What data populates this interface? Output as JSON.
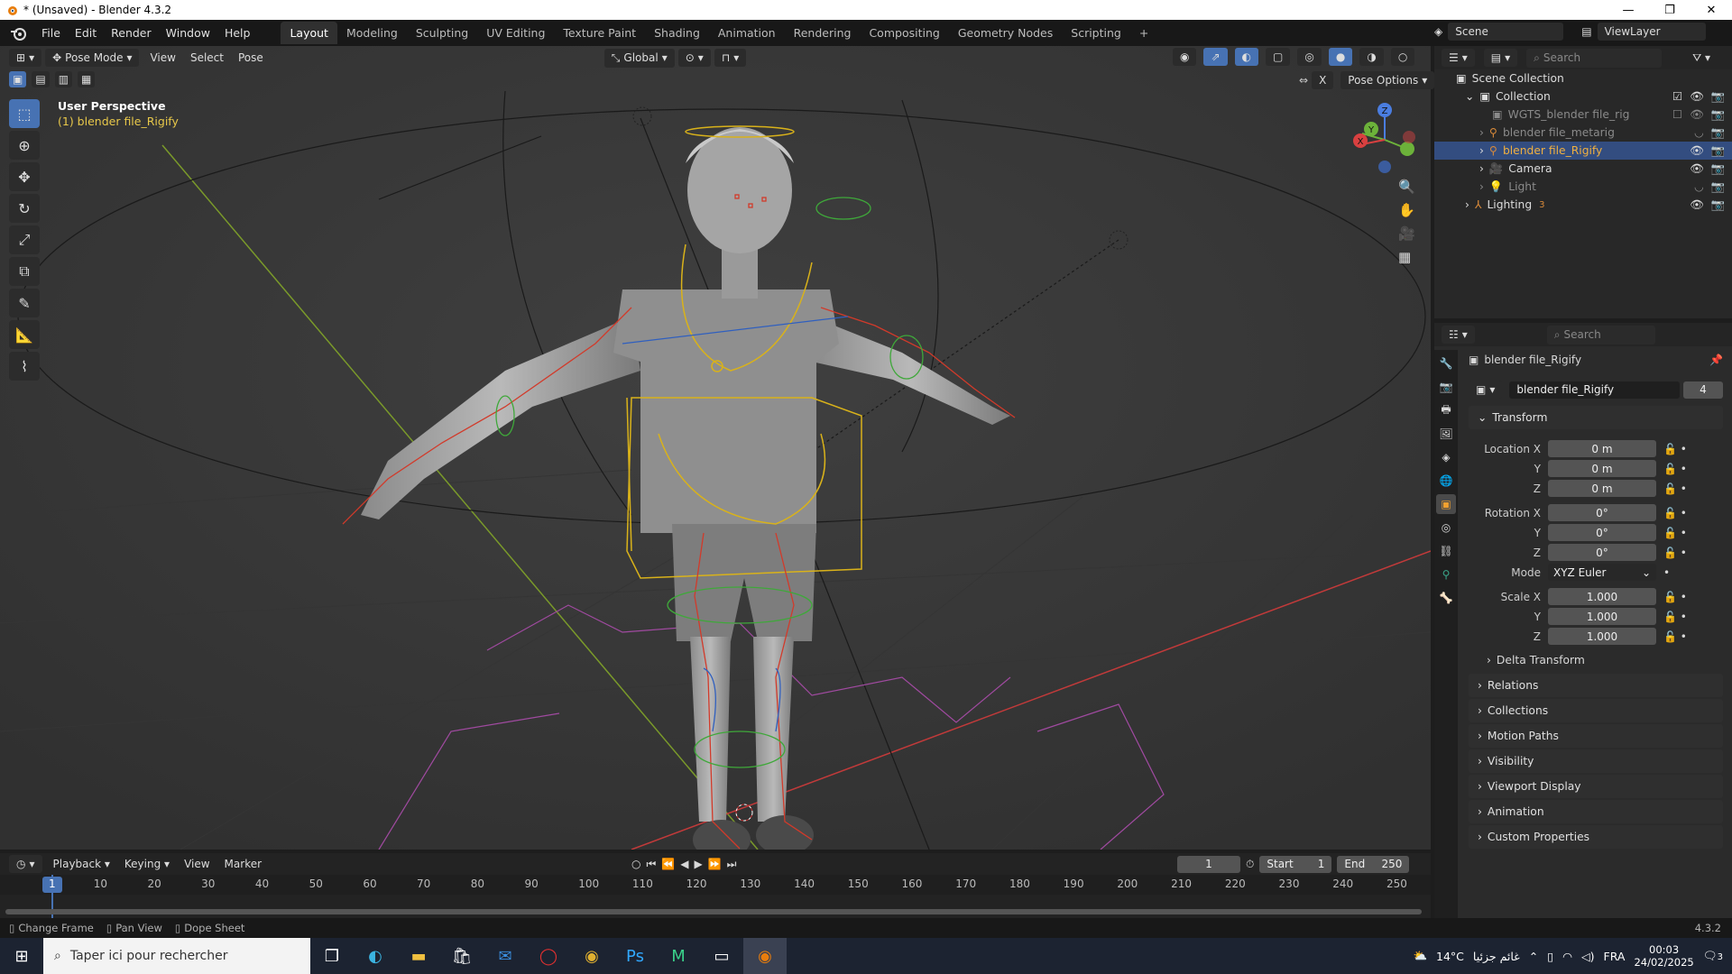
{
  "window": {
    "title": "* (Unsaved) - Blender 4.3.2",
    "minimize": "—",
    "maximize": "❐",
    "close": "✕"
  },
  "menu": [
    "File",
    "Edit",
    "Render",
    "Window",
    "Help"
  ],
  "workspaces": [
    "Layout",
    "Modeling",
    "Sculpting",
    "UV Editing",
    "Texture Paint",
    "Shading",
    "Animation",
    "Rendering",
    "Compositing",
    "Geometry Nodes",
    "Scripting",
    "+"
  ],
  "active_workspace": "Layout",
  "scene": {
    "label": "Scene",
    "viewlayer": "ViewLayer"
  },
  "viewport": {
    "mode": "Pose Mode",
    "view": "View",
    "select": "Select",
    "pose": "Pose",
    "transform_orientation": "Global",
    "pose_options": "Pose Options",
    "overlay_title": "User Perspective",
    "overlay_object": "(1) blender file_Rigify",
    "gizmo": {
      "x": "X",
      "y": "Y",
      "z": "Z"
    },
    "x_mirror": "X"
  },
  "outliner": {
    "search_placeholder": "Search",
    "items": [
      {
        "label": "Scene Collection",
        "indent": 0
      },
      {
        "label": "Collection",
        "indent": 1
      },
      {
        "label": "WGTS_blender file_rig",
        "indent": 2,
        "dim": true
      },
      {
        "label": "blender file_metarig",
        "indent": 2,
        "dim": true
      },
      {
        "label": "blender file_Rigify",
        "indent": 2,
        "selected": true
      },
      {
        "label": "Camera",
        "indent": 2
      },
      {
        "label": "Light",
        "indent": 2,
        "dim": true
      },
      {
        "label": "Lighting",
        "indent": 1,
        "badge": "3"
      }
    ]
  },
  "properties": {
    "search_placeholder": "Search",
    "object_name": "blender file_Rigify",
    "data_name": "blender file_Rigify",
    "users": "4",
    "transform_label": "Transform",
    "location": {
      "label_x": "Location X",
      "label_y": "Y",
      "label_z": "Z",
      "x": "0 m",
      "y": "0 m",
      "z": "0 m"
    },
    "rotation": {
      "label_x": "Rotation X",
      "label_y": "Y",
      "label_z": "Z",
      "x": "0°",
      "y": "0°",
      "z": "0°"
    },
    "mode": {
      "label": "Mode",
      "value": "XYZ Euler"
    },
    "scale": {
      "label_x": "Scale X",
      "label_y": "Y",
      "label_z": "Z",
      "x": "1.000",
      "y": "1.000",
      "z": "1.000"
    },
    "delta_transform": "Delta Transform",
    "panels": [
      "Relations",
      "Collections",
      "Motion Paths",
      "Visibility",
      "Viewport Display",
      "Animation",
      "Custom Properties"
    ]
  },
  "timeline": {
    "playback": "Playback",
    "keying": "Keying",
    "view": "View",
    "marker": "Marker",
    "current_frame": "1",
    "start_label": "Start",
    "start": "1",
    "end_label": "End",
    "end": "250",
    "ruler": [
      "1",
      "10",
      "20",
      "30",
      "40",
      "50",
      "60",
      "70",
      "80",
      "90",
      "100",
      "110",
      "120",
      "130",
      "140",
      "150",
      "160",
      "170",
      "180",
      "190",
      "200",
      "210",
      "220",
      "230",
      "240",
      "250"
    ]
  },
  "status": {
    "change_frame": "Change Frame",
    "pan_view": "Pan View",
    "dope_sheet": "Dope Sheet",
    "version": "4.3.2"
  },
  "taskbar": {
    "search_placeholder": "Taper ici pour rechercher",
    "weather": "14°C",
    "weather_desc": "غائم جزئيا",
    "lang": "FRA",
    "time": "00:03",
    "date": "24/02/2025",
    "notif": "3"
  },
  "colors": {
    "accent_blue": "#4772b3",
    "selected_row": "#334d80",
    "viewport_bg": "#3a3a3a",
    "rig_yellow": "#d9b21a",
    "rig_red": "#d23a2a",
    "rig_green": "#3fa83a"
  }
}
